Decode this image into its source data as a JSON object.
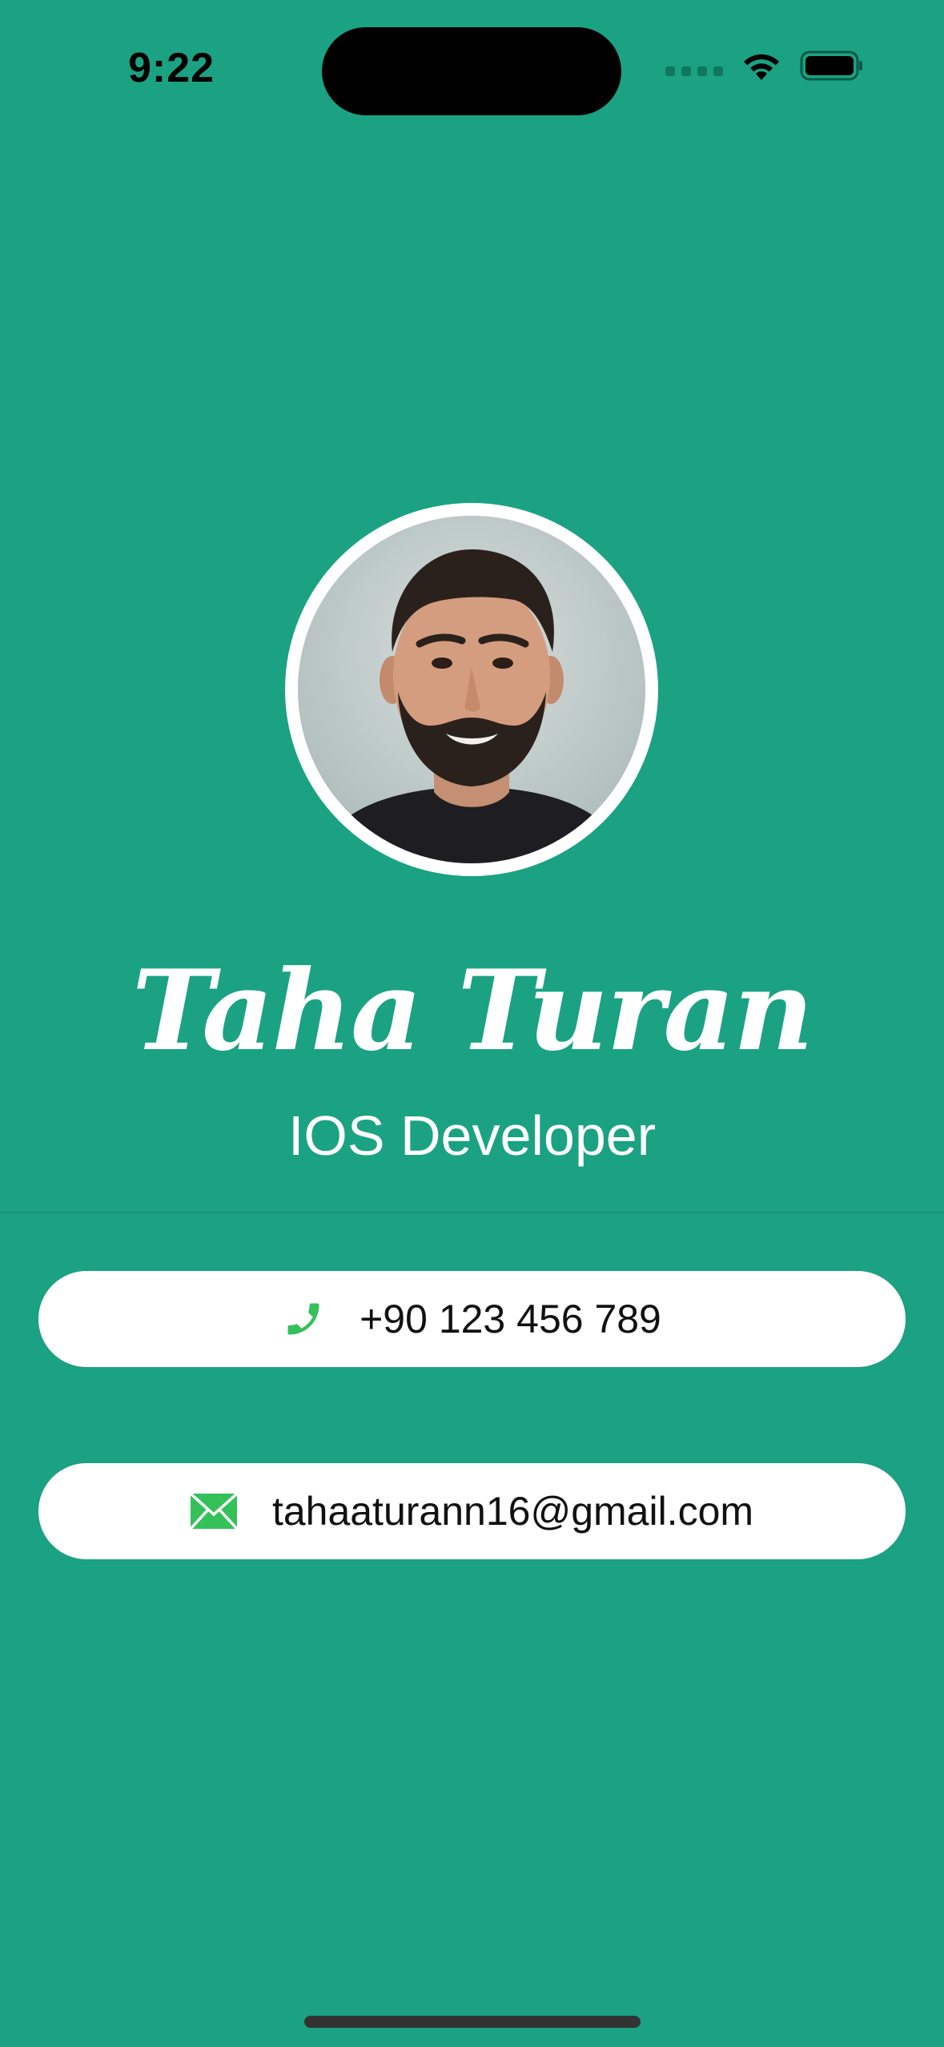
{
  "status_bar": {
    "time": "9:22",
    "icons": [
      "cellular-signal-icon",
      "wifi-icon",
      "battery-icon"
    ]
  },
  "profile": {
    "name": "Taha Turan",
    "role": "IOS Developer",
    "avatar": "profile-photo"
  },
  "contacts": {
    "phone": {
      "icon": "phone-icon",
      "text": "+90 123 456 789"
    },
    "email": {
      "icon": "envelope-icon",
      "text": "tahaaturann16@gmail.com"
    }
  },
  "colors": {
    "background": "#1aa283",
    "card": "#ffffff",
    "icon_accent": "#34c15a",
    "text_primary": "#ffffff",
    "text_card": "#111111"
  }
}
